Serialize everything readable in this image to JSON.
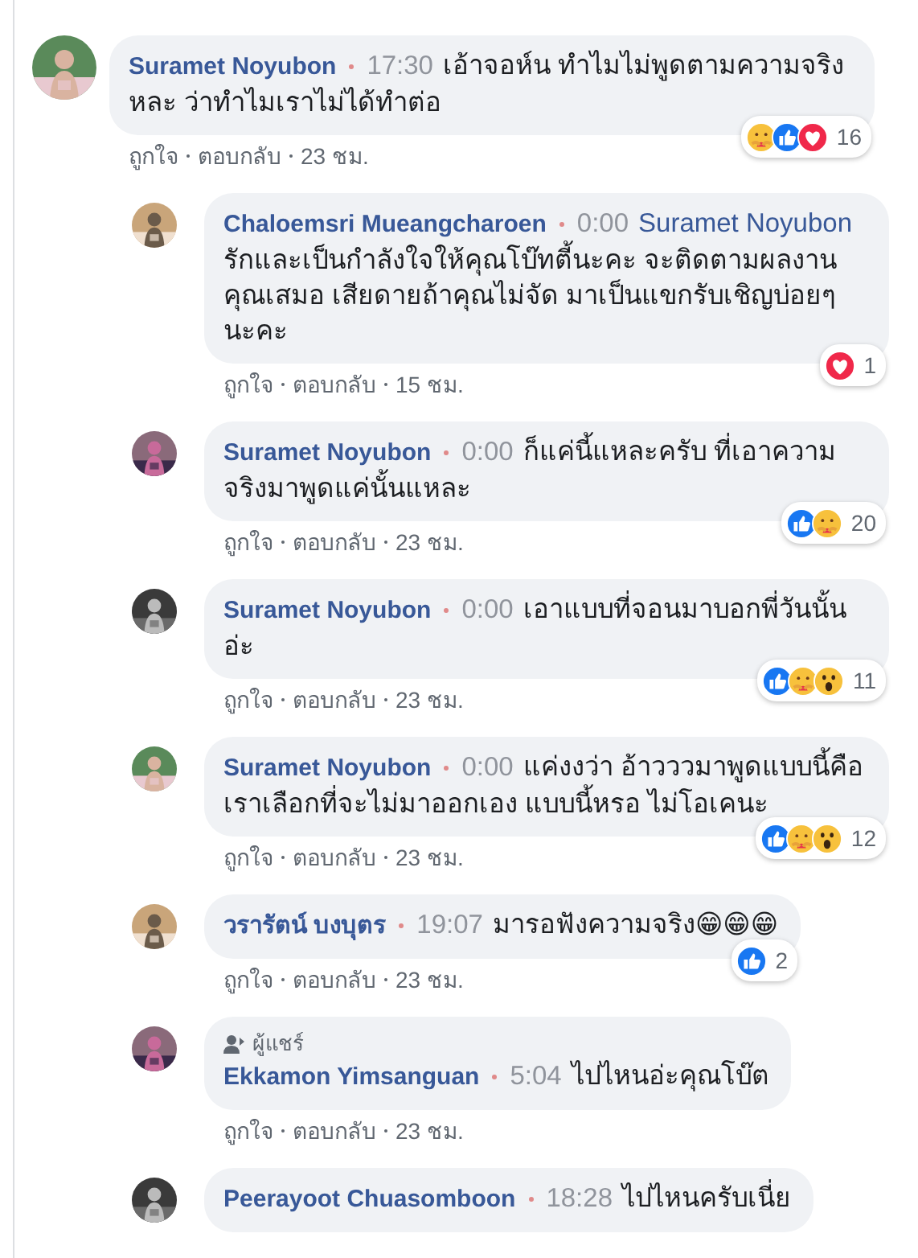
{
  "comments": [
    {
      "author": "Suramet Noyubon",
      "time": "17:30",
      "text": "เอ้าจอห์น ทำไมไม่พูดตามความจริงหละ ว่าทำไมเราไม่ได้ทำต่อ",
      "actions": [
        "ถูกใจ",
        "ตอบกลับ",
        "23 ชม."
      ],
      "reactions": {
        "icons": [
          {
            "kind": "care"
          },
          {
            "kind": "like"
          },
          {
            "kind": "love"
          }
        ],
        "count": "16"
      },
      "children": [
        {
          "author": "Chaloemsri Mueangcharoen",
          "time": "0:00",
          "mention": "Suramet Noyubon",
          "text": "รักและเป็นกำลังใจให้คุณโบ๊ทตี้นะคะ จะติดตามผลงานคุณเสมอ เสียดายถ้าคุณไม่จัด มาเป็นแขกรับเชิญบ่อยๆนะคะ",
          "actions": [
            "ถูกใจ",
            "ตอบกลับ",
            "15 ชม."
          ],
          "reactions": {
            "icons": [
              {
                "kind": "love"
              }
            ],
            "count": "1"
          }
        },
        {
          "author": "Suramet Noyubon",
          "time": "0:00",
          "text": "ก็แค่นี้แหละครับ ที่เอาความจริงมาพูดแค่นั้นแหละ",
          "actions": [
            "ถูกใจ",
            "ตอบกลับ",
            "23 ชม."
          ],
          "reactions": {
            "icons": [
              {
                "kind": "like"
              },
              {
                "kind": "care"
              }
            ],
            "count": "20"
          }
        },
        {
          "author": "Suramet Noyubon",
          "time": "0:00",
          "text": "เอาแบบที่จอนมาบอกพี่วันนั้นอ่ะ",
          "actions": [
            "ถูกใจ",
            "ตอบกลับ",
            "23 ชม."
          ],
          "reactions": {
            "icons": [
              {
                "kind": "like"
              },
              {
                "kind": "care"
              },
              {
                "kind": "wow"
              }
            ],
            "count": "11"
          }
        },
        {
          "author": "Suramet Noyubon",
          "time": "0:00",
          "text": "แค่งงว่า อ้าวววมาพูดแบบนี้คือเราเลือกที่จะไม่มาออกเอง แบบนี้หรอ ไม่โอเคนะ",
          "actions": [
            "ถูกใจ",
            "ตอบกลับ",
            "23 ชม."
          ],
          "reactions": {
            "icons": [
              {
                "kind": "like"
              },
              {
                "kind": "care"
              },
              {
                "kind": "wow"
              }
            ],
            "count": "12"
          }
        },
        {
          "author": "วรารัตน์ บงบุตร",
          "time": "19:07",
          "text": "มารอฟังความจริง😁😁😁",
          "actions": [
            "ถูกใจ",
            "ตอบกลับ",
            "23 ชม."
          ],
          "reactions": {
            "icons": [
              {
                "kind": "like"
              }
            ],
            "count": "2"
          }
        },
        {
          "author": "Ekkamon Yimsanguan",
          "badge": "ผู้แชร์",
          "time": "5:04",
          "text": "ไปไหนอ่ะคุณโบ๊ต",
          "actions": [
            "ถูกใจ",
            "ตอบกลับ",
            "23 ชม."
          ]
        },
        {
          "author": "Peerayoot Chuasomboon",
          "time": "18:28",
          "text": "ไปไหนครับเนี่ย"
        }
      ]
    }
  ]
}
